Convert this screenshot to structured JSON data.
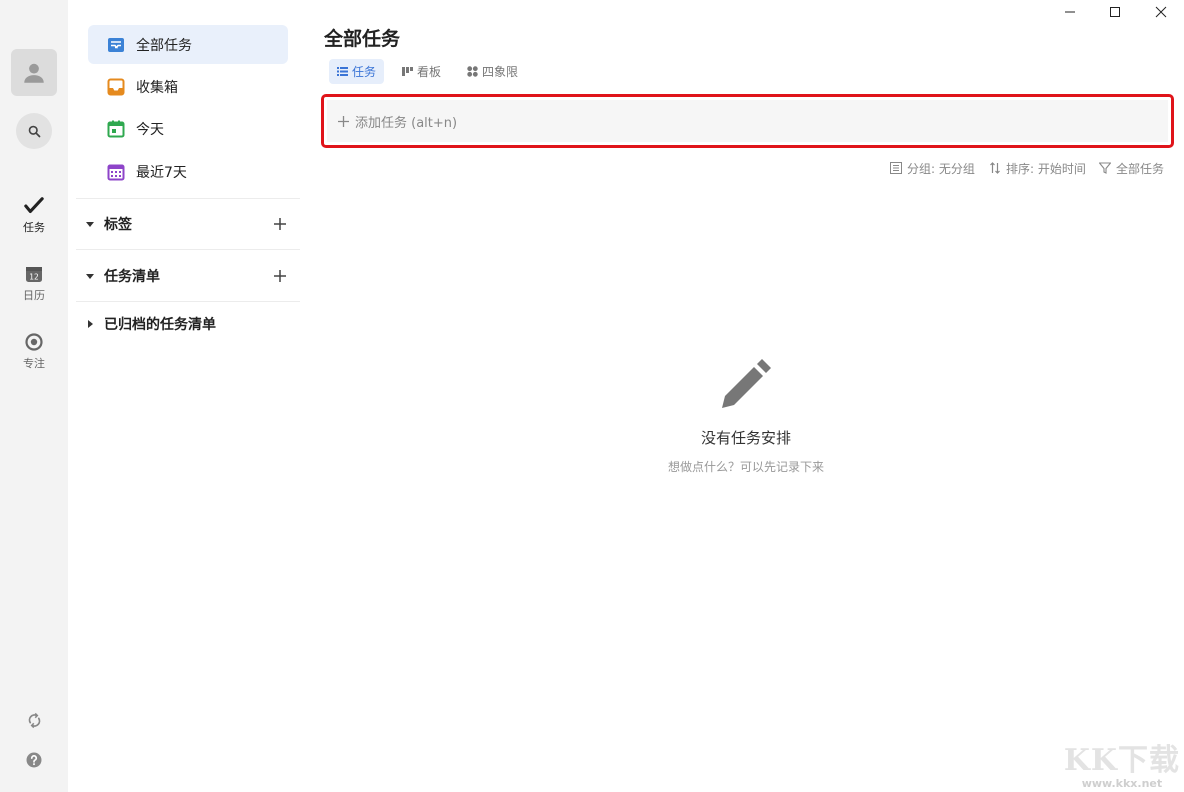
{
  "window_controls": {
    "minimize": "—",
    "maximize": "☐",
    "close": "✕"
  },
  "rail": {
    "items": [
      {
        "label": "任务",
        "icon": "check-icon",
        "active": true
      },
      {
        "label": "日历",
        "icon": "calendar-icon",
        "badge": "12"
      },
      {
        "label": "专注",
        "icon": "focus-icon"
      }
    ],
    "bottom": [
      {
        "icon": "sync-icon"
      },
      {
        "icon": "help-icon"
      }
    ]
  },
  "sidebar": {
    "items": [
      {
        "label": "全部任务",
        "icon": "all-tasks-icon",
        "color": "#3b82d6",
        "active": true
      },
      {
        "label": "收集箱",
        "icon": "inbox-icon",
        "color": "#e58a1e"
      },
      {
        "label": "今天",
        "icon": "today-icon",
        "color": "#2fa84f"
      },
      {
        "label": "最近7天",
        "icon": "next7days-icon",
        "color": "#8e44c9"
      }
    ],
    "sections": [
      {
        "label": "标签",
        "expanded": true,
        "has_add": true
      },
      {
        "label": "任务清单",
        "expanded": true,
        "has_add": true
      },
      {
        "label": "已归档的任务清单",
        "expanded": false,
        "has_add": false
      }
    ]
  },
  "main": {
    "title": "全部任务",
    "view_tabs": [
      {
        "label": "任务",
        "icon": "list-icon",
        "active": true
      },
      {
        "label": "看板",
        "icon": "kanban-icon"
      },
      {
        "label": "四象限",
        "icon": "quadrant-icon"
      }
    ],
    "add_task": {
      "placeholder": "添加任务 (alt+n)"
    },
    "tools": {
      "group": "分组: 无分组",
      "sort": "排序: 开始时间",
      "filter": "全部任务"
    },
    "empty": {
      "title": "没有任务安排",
      "subtitle": "想做点什么？可以先记录下来"
    }
  },
  "watermark": {
    "big": "KK下载",
    "small": "www.kkx.net"
  },
  "colors": {
    "accent": "#3a74d6",
    "highlight_border": "#e0141a"
  }
}
